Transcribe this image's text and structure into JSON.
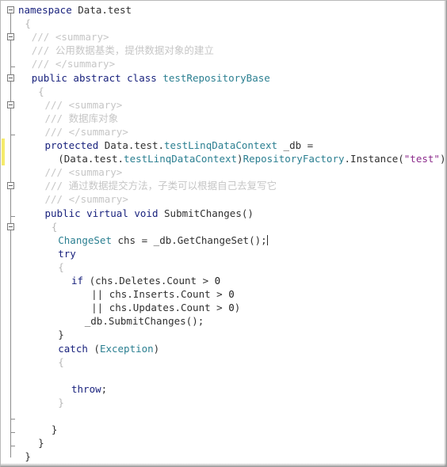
{
  "window": {
    "title": "Code Editor",
    "kind": "source-code-view",
    "language": "C#",
    "background": "#ffffff",
    "border_color": "#b9b9b9"
  },
  "colors": {
    "keyword": "#19227d",
    "type": "#2b7f91",
    "string": "#8c2c8c",
    "comment": "#c6c6c6",
    "plain": "#202020",
    "change_bar": "#f5eb6b",
    "fold_line": "#8d8d8d"
  },
  "gutter": {
    "change_bar_label": "unsaved-change-marker",
    "fold_markers": [
      {
        "line": 1,
        "type": "collapse-box"
      },
      {
        "line": 3,
        "type": "collapse-box"
      },
      {
        "line": 5,
        "type": "segment-end"
      },
      {
        "line": 6,
        "type": "collapse-box"
      },
      {
        "line": 8,
        "type": "collapse-box"
      },
      {
        "line": 10,
        "type": "segment-end"
      },
      {
        "line": 14,
        "type": "collapse-box"
      },
      {
        "line": 16,
        "type": "segment-end"
      },
      {
        "line": 17,
        "type": "collapse-box"
      },
      {
        "line": 31,
        "type": "segment-end"
      },
      {
        "line": 32,
        "type": "segment-end"
      },
      {
        "line": 33,
        "type": "segment-end"
      }
    ]
  },
  "caret": {
    "line": 20,
    "after_text": "ChangeSet chs = _db.GetChangeSet();"
  },
  "code": {
    "lines": [
      {
        "n": 1,
        "indent": 0,
        "tokens": [
          {
            "t": "namespace ",
            "c": "kw"
          },
          {
            "t": "Data.test",
            "c": "plain"
          }
        ]
      },
      {
        "n": 2,
        "indent": 1,
        "tokens": [
          {
            "t": "{",
            "c": "brace"
          }
        ]
      },
      {
        "n": 3,
        "indent": 2,
        "tokens": [
          {
            "t": "/// <summary>",
            "c": "cmt"
          }
        ]
      },
      {
        "n": 4,
        "indent": 2,
        "tokens": [
          {
            "t": "/// ",
            "c": "cmt"
          },
          {
            "t": "公用数据基类，提供数据对象的建立",
            "c": "cjk"
          }
        ]
      },
      {
        "n": 5,
        "indent": 2,
        "tokens": [
          {
            "t": "/// </summary>",
            "c": "cmt"
          }
        ]
      },
      {
        "n": 6,
        "indent": 2,
        "tokens": [
          {
            "t": "public abstract class ",
            "c": "kw"
          },
          {
            "t": "testRepositoryBase",
            "c": "type"
          }
        ]
      },
      {
        "n": 7,
        "indent": 3,
        "tokens": [
          {
            "t": "{",
            "c": "brace"
          }
        ]
      },
      {
        "n": 8,
        "indent": 4,
        "tokens": [
          {
            "t": "/// <summary>",
            "c": "cmt"
          }
        ]
      },
      {
        "n": 9,
        "indent": 4,
        "tokens": [
          {
            "t": "/// ",
            "c": "cmt"
          },
          {
            "t": "数据库对象",
            "c": "cjk"
          }
        ]
      },
      {
        "n": 10,
        "indent": 4,
        "tokens": [
          {
            "t": "/// </summary>",
            "c": "cmt"
          }
        ]
      },
      {
        "n": 11,
        "indent": 4,
        "tokens": [
          {
            "t": "protected ",
            "c": "kw"
          },
          {
            "t": "Data.test.",
            "c": "plain"
          },
          {
            "t": "testLinqDataContext",
            "c": "type"
          },
          {
            "t": " _db =",
            "c": "plain"
          }
        ]
      },
      {
        "n": 12,
        "indent": 6,
        "tokens": [
          {
            "t": "(Data.test.",
            "c": "plain"
          },
          {
            "t": "testLinqDataContext",
            "c": "type"
          },
          {
            "t": ")",
            "c": "plain"
          },
          {
            "t": "RepositoryFactory",
            "c": "type"
          },
          {
            "t": ".Instance(",
            "c": "plain"
          },
          {
            "t": "\"test\"",
            "c": "str"
          },
          {
            "t": ");",
            "c": "plain"
          }
        ]
      },
      {
        "n": 13,
        "indent": 4,
        "tokens": [
          {
            "t": "/// <summary>",
            "c": "cmt"
          }
        ]
      },
      {
        "n": 14,
        "indent": 4,
        "tokens": [
          {
            "t": "/// ",
            "c": "cmt"
          },
          {
            "t": "通过数据提交方法，子类可以根据自己去复写它",
            "c": "cjk"
          }
        ]
      },
      {
        "n": 15,
        "indent": 4,
        "tokens": [
          {
            "t": "/// </summary>",
            "c": "cmt"
          }
        ]
      },
      {
        "n": 16,
        "indent": 4,
        "tokens": [
          {
            "t": "public virtual void ",
            "c": "kw"
          },
          {
            "t": "SubmitChanges()",
            "c": "plain"
          }
        ]
      },
      {
        "n": 17,
        "indent": 5,
        "tokens": [
          {
            "t": "{",
            "c": "brace"
          }
        ]
      },
      {
        "n": 18,
        "indent": 6,
        "tokens": [
          {
            "t": "ChangeSet",
            "c": "type"
          },
          {
            "t": " chs = _db.GetChangeSet();",
            "c": "plain"
          },
          {
            "t": "|CARET|",
            "c": "caret"
          }
        ]
      },
      {
        "n": 19,
        "indent": 6,
        "tokens": [
          {
            "t": "try",
            "c": "kw"
          }
        ]
      },
      {
        "n": 20,
        "indent": 6,
        "tokens": [
          {
            "t": "{",
            "c": "brace"
          }
        ]
      },
      {
        "n": 21,
        "indent": 8,
        "tokens": [
          {
            "t": "if ",
            "c": "kw"
          },
          {
            "t": "(chs.Deletes.Count > ",
            "c": "plain"
          },
          {
            "t": "0",
            "c": "num"
          }
        ]
      },
      {
        "n": 22,
        "indent": 11,
        "tokens": [
          {
            "t": "|| chs.Inserts.Count > ",
            "c": "plain"
          },
          {
            "t": "0",
            "c": "num"
          }
        ]
      },
      {
        "n": 23,
        "indent": 11,
        "tokens": [
          {
            "t": "|| chs.Updates.Count > ",
            "c": "plain"
          },
          {
            "t": "0",
            "c": "num"
          },
          {
            "t": ")",
            "c": "plain"
          }
        ]
      },
      {
        "n": 24,
        "indent": 10,
        "tokens": [
          {
            "t": "_db.SubmitChanges();",
            "c": "plain"
          }
        ]
      },
      {
        "n": 25,
        "indent": 6,
        "tokens": [
          {
            "t": "}",
            "c": "plain"
          }
        ]
      },
      {
        "n": 26,
        "indent": 6,
        "tokens": [
          {
            "t": "catch ",
            "c": "kw"
          },
          {
            "t": "(",
            "c": "plain"
          },
          {
            "t": "Exception",
            "c": "type"
          },
          {
            "t": ")",
            "c": "plain"
          }
        ]
      },
      {
        "n": 27,
        "indent": 6,
        "tokens": [
          {
            "t": "{",
            "c": "brace"
          }
        ]
      },
      {
        "n": 28,
        "indent": 0,
        "tokens": [
          {
            "t": "",
            "c": "plain"
          }
        ]
      },
      {
        "n": 29,
        "indent": 8,
        "tokens": [
          {
            "t": "throw",
            "c": "kw"
          },
          {
            "t": ";",
            "c": "plain"
          }
        ]
      },
      {
        "n": 30,
        "indent": 6,
        "tokens": [
          {
            "t": "}",
            "c": "brace"
          }
        ]
      },
      {
        "n": 31,
        "indent": 0,
        "tokens": [
          {
            "t": "",
            "c": "plain"
          }
        ]
      },
      {
        "n": 32,
        "indent": 5,
        "tokens": [
          {
            "t": "}",
            "c": "plain"
          }
        ]
      },
      {
        "n": 33,
        "indent": 3,
        "tokens": [
          {
            "t": "}",
            "c": "plain"
          }
        ]
      },
      {
        "n": 34,
        "indent": 1,
        "tokens": [
          {
            "t": "}",
            "c": "plain"
          }
        ]
      }
    ]
  }
}
